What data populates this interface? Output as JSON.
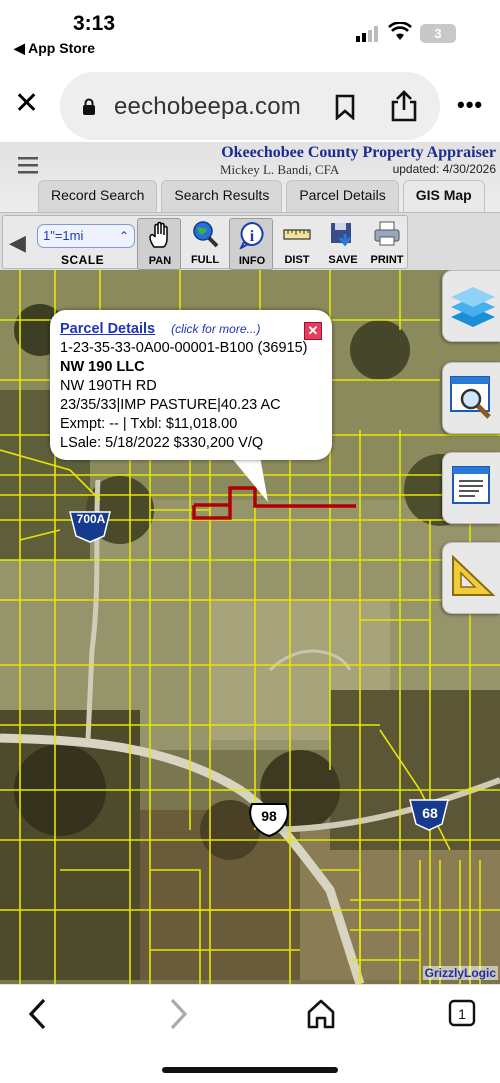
{
  "status_bar": {
    "time": "3:13",
    "back_label": "◀ App Store",
    "battery": "3"
  },
  "browser": {
    "url": "eechobeepa.com"
  },
  "site": {
    "org_name": "Okeechobee County Property Appraiser",
    "person": "Mickey L. Bandi, CFA",
    "updated": "updated: 4/30/2026",
    "tabs": [
      "Record Search",
      "Search Results",
      "Parcel Details",
      "GIS Map"
    ],
    "active_tab": "GIS Map"
  },
  "toolbar": {
    "scale_value": "1\"=1mi",
    "scale_label": "SCALE",
    "tools": [
      "PAN",
      "FULL",
      "INFO",
      "DIST",
      "SAVE",
      "PRINT"
    ]
  },
  "popup": {
    "title": "Parcel Details",
    "more": "(click for more...)",
    "parcel_id": "1-23-35-33-0A00-00001-B100 (36915)",
    "owner": "NW 190 LLC",
    "address": "NW 190TH RD",
    "land": "23/35/33|IMP PASTURE|40.23 AC",
    "exempt": "Exmpt: -- | Txbl: $11,018.00",
    "sale": "LSale: 5/18/2022 $330,200 V/Q"
  },
  "map": {
    "route_labels": [
      "700A",
      "98",
      "68"
    ],
    "credit": "GrizzlyLogic",
    "parcel_line_color": "#e6e600",
    "highlight_color": "#b00000"
  }
}
